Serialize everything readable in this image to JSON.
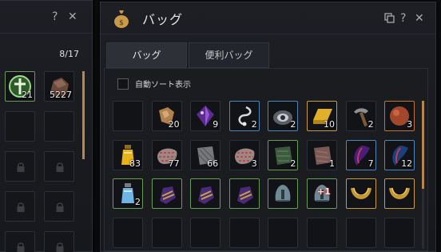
{
  "left_window": {
    "help_label": "?",
    "close_label": "✕",
    "count": "8/17",
    "items": [
      {
        "icon": "compass-emblem-icon",
        "qty": "21"
      },
      {
        "icon": "ore-chunk-icon",
        "qty": "5227"
      }
    ]
  },
  "bag_window": {
    "title": "バッグ",
    "tabs": [
      {
        "label": "バッグ",
        "active": true
      },
      {
        "label": "便利バッグ",
        "active": false
      }
    ],
    "auto_sort_label": "自動ソート表示",
    "auto_sort_checked": false,
    "slots": [
      {
        "icon": "empty"
      },
      {
        "icon": "wood-chips-icon",
        "qty": "20"
      },
      {
        "icon": "purple-crystal-icon",
        "qty": "9"
      },
      {
        "icon": "silver-earring-icon",
        "qty": "2"
      },
      {
        "icon": "eye-gem-icon",
        "qty": "2"
      },
      {
        "icon": "gold-bar-icon",
        "qty": "10"
      },
      {
        "icon": "pickaxe-hoe-icon",
        "qty": "2"
      },
      {
        "icon": "copper-orb-icon",
        "qty": "3"
      },
      {
        "icon": "yellow-potion-icon",
        "qty": "83"
      },
      {
        "icon": "striped-hide-icon",
        "qty": "77"
      },
      {
        "icon": "grey-hide-icon",
        "qty": "66"
      },
      {
        "icon": "striped-hide-icon",
        "qty": "3"
      },
      {
        "icon": "green-hide-icon",
        "qty": "2"
      },
      {
        "icon": "brown-hide-icon",
        "qty": "1"
      },
      {
        "icon": "purple-wing-icon",
        "qty": "7"
      },
      {
        "icon": "blue-wing-icon",
        "qty": "12"
      },
      {
        "icon": "blue-potion-icon",
        "qty": "2"
      },
      {
        "icon": "purple-glove-icon"
      },
      {
        "icon": "purple-glove-icon"
      },
      {
        "icon": "purple-glove-icon"
      },
      {
        "icon": "steel-helmet-icon"
      },
      {
        "icon": "steel-helmet-icon",
        "enhance": "+1"
      },
      {
        "icon": "gold-necklace-icon"
      },
      {
        "icon": "gold-necklace-icon"
      },
      {
        "icon": "empty"
      },
      {
        "icon": "empty"
      },
      {
        "icon": "empty"
      },
      {
        "icon": "empty"
      },
      {
        "icon": "empty"
      },
      {
        "icon": "empty"
      },
      {
        "icon": "empty"
      },
      {
        "icon": "empty"
      }
    ]
  }
}
